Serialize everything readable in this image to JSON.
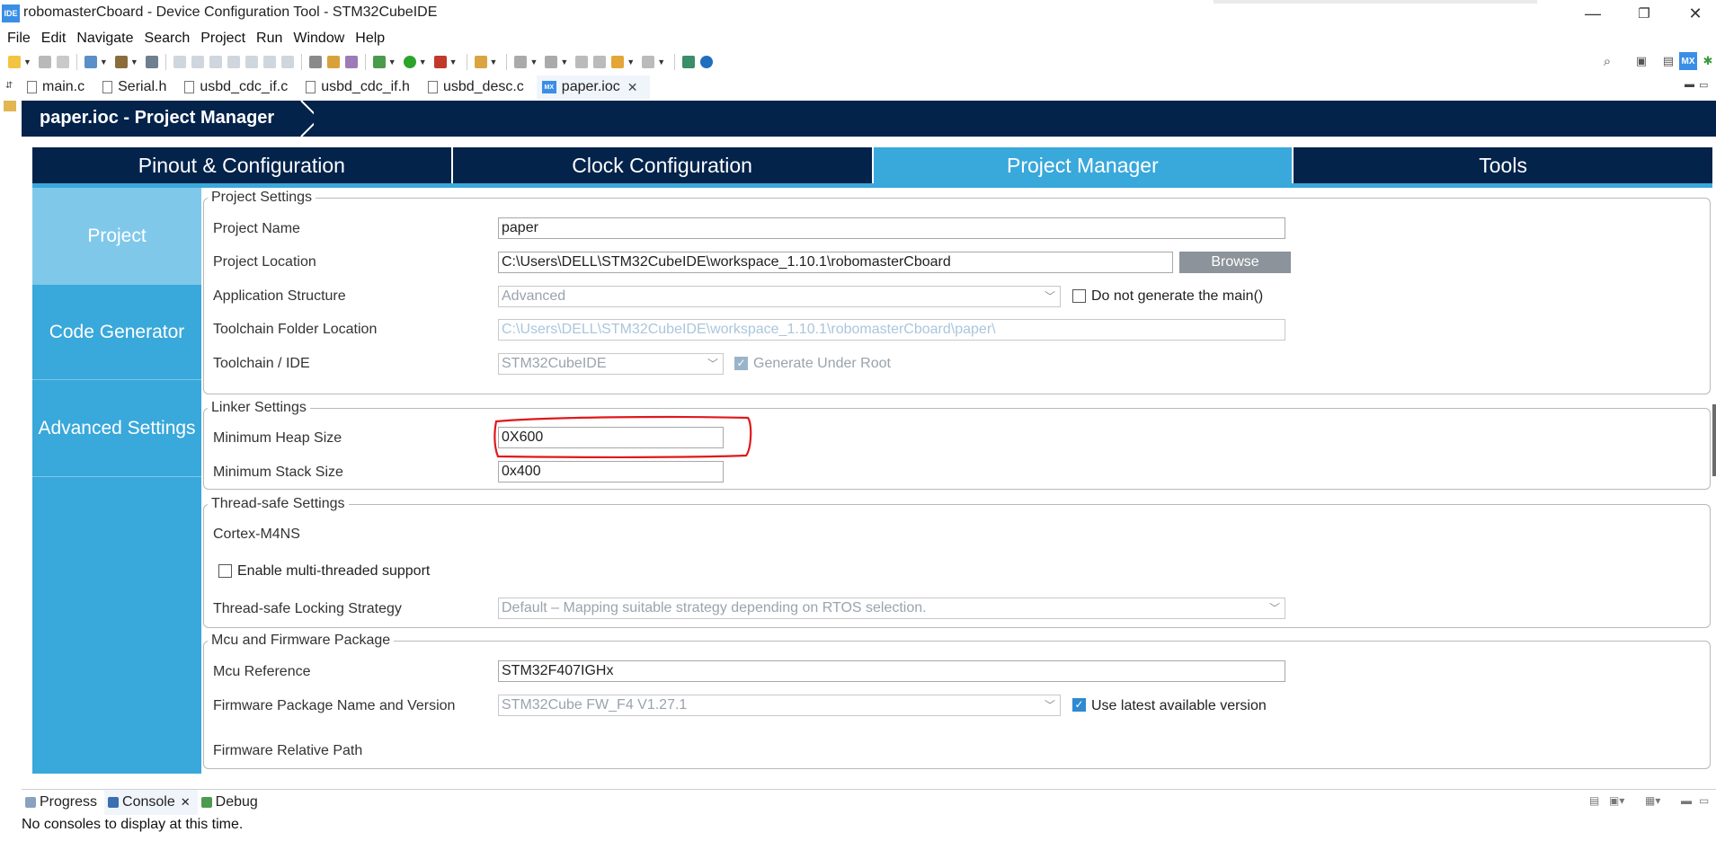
{
  "window": {
    "app_icon_text": "IDE",
    "title": "robomasterCboard - Device Configuration Tool - STM32CubeIDE",
    "minimize": "—",
    "restore": "❐",
    "close": "✕"
  },
  "menu": [
    "File",
    "Edit",
    "Navigate",
    "Search",
    "Project",
    "Run",
    "Window",
    "Help"
  ],
  "editor_tabs": [
    {
      "label": "main.c",
      "icon": "c-file-icon"
    },
    {
      "label": "Serial.h",
      "icon": "h-file-icon"
    },
    {
      "label": "usbd_cdc_if.c",
      "icon": "c-file-icon"
    },
    {
      "label": "usbd_cdc_if.h",
      "icon": "h-file-icon"
    },
    {
      "label": "usbd_desc.c",
      "icon": "c-file-icon"
    },
    {
      "label": "paper.ioc",
      "icon": "mx-icon",
      "icon_text": "MX",
      "active": true,
      "close": "✕"
    }
  ],
  "banner": {
    "title": "paper.ioc - Project Manager"
  },
  "main_tabs": [
    "Pinout & Configuration",
    "Clock Configuration",
    "Project Manager",
    "Tools"
  ],
  "active_main_tab": "Project Manager",
  "left_nav": [
    "Project",
    "Code Generator",
    "Advanced Settings"
  ],
  "active_nav": "Project",
  "project_settings": {
    "title": "Project Settings",
    "name_label": "Project Name",
    "name_value": "paper",
    "location_label": "Project Location",
    "location_value": "C:\\Users\\DELL\\STM32CubeIDE\\workspace_1.10.1\\robomasterCboard",
    "browse_label": "Browse",
    "app_structure_label": "Application Structure",
    "app_structure_value": "Advanced",
    "no_main_label": "Do not generate the main()",
    "no_main_checked": false,
    "toolchain_folder_label": "Toolchain Folder Location",
    "toolchain_folder_value": "C:\\Users\\DELL\\STM32CubeIDE\\workspace_1.10.1\\robomasterCboard\\paper\\",
    "toolchain_ide_label": "Toolchain / IDE",
    "toolchain_ide_value": "STM32CubeIDE",
    "generate_under_root_label": "Generate Under Root",
    "generate_under_root_checked": true
  },
  "linker_settings": {
    "title": "Linker Settings",
    "heap_label": "Minimum Heap Size",
    "heap_value": "0X600",
    "stack_label": "Minimum Stack Size",
    "stack_value": "0x400",
    "highlight_color": "#e0181b"
  },
  "thread_safe": {
    "title": "Thread-safe Settings",
    "core_label": "Cortex-M4NS",
    "multithread_label": "Enable multi-threaded support",
    "multithread_checked": false,
    "strategy_label": "Thread-safe Locking Strategy",
    "strategy_value": "Default  –  Mapping suitable strategy depending on RTOS selection."
  },
  "mcu_firmware": {
    "title": "Mcu and Firmware Package",
    "mcu_ref_label": "Mcu Reference",
    "mcu_ref_value": "STM32F407IGHx",
    "fw_label": "Firmware Package Name and Version",
    "fw_value": "STM32Cube FW_F4 V1.27.1",
    "use_latest_label": "Use latest available version",
    "use_latest_checked": true,
    "relative_path_label": "Firmware Relative Path"
  },
  "bottom_panel": {
    "tabs": [
      {
        "label": "Progress",
        "icon": "progress-icon"
      },
      {
        "label": "Console",
        "icon": "console-icon",
        "active": true,
        "close": "✕"
      },
      {
        "label": "Debug",
        "icon": "debug-icon"
      }
    ],
    "message": "No consoles to display at this time."
  },
  "colors": {
    "navy": "#03234b",
    "accent": "#39a8db",
    "nav_active": "#7fc8ea"
  }
}
